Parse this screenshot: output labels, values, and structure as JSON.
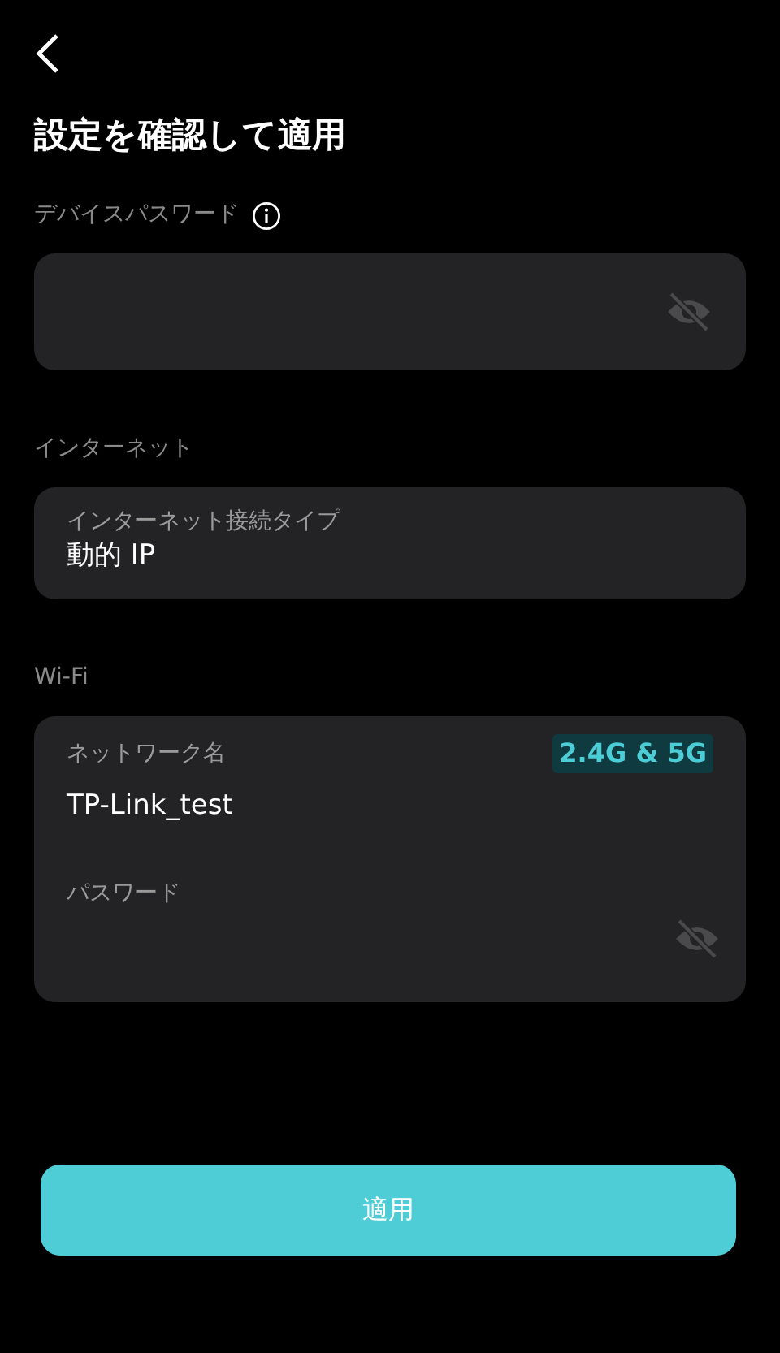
{
  "header": {
    "title": "設定を確認して適用"
  },
  "device_password": {
    "label": "デバイスパスワード",
    "password_visible": false
  },
  "internet": {
    "section": "インターネット",
    "label": "インターネット接続タイプ",
    "value": "動的 IP"
  },
  "wifi": {
    "section": "Wi-Fi",
    "name_label": "ネットワーク名",
    "band": "2.4G & 5G",
    "name_value": "TP-Link_test",
    "password_label": "パスワード",
    "password_visible": false
  },
  "apply_button": "適用"
}
